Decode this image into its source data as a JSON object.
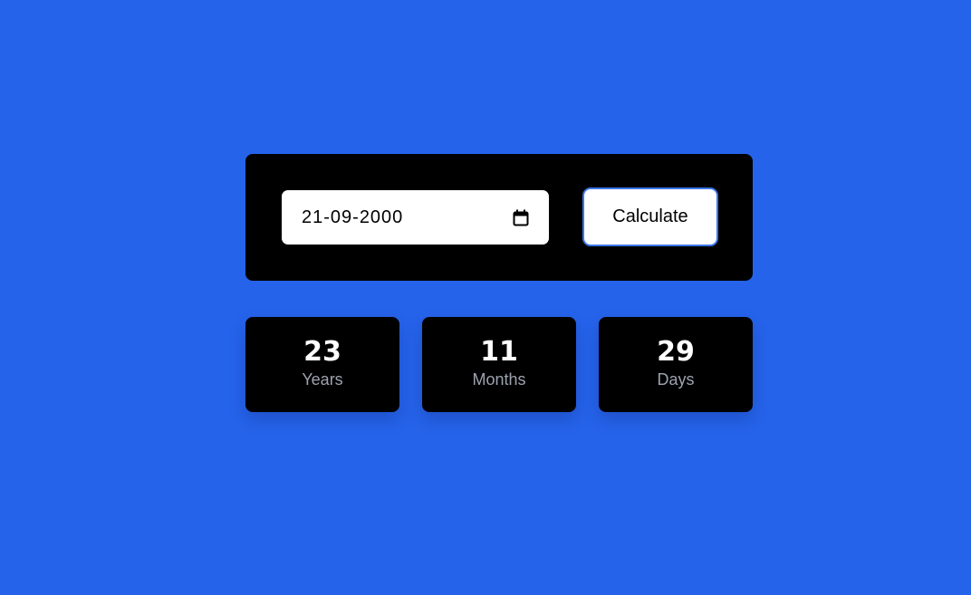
{
  "form": {
    "date_value": "21-09-2000",
    "calculate_label": "Calculate"
  },
  "icons": {
    "date_picker": "calendar-icon"
  },
  "results": {
    "years": {
      "value": "23",
      "label": "Years"
    },
    "months": {
      "value": "11",
      "label": "Months"
    },
    "days": {
      "value": "29",
      "label": "Days"
    }
  },
  "colors": {
    "background": "#2563eb",
    "panel": "#000000",
    "button_border": "#3b76e6",
    "label_text": "#9ca3af"
  }
}
